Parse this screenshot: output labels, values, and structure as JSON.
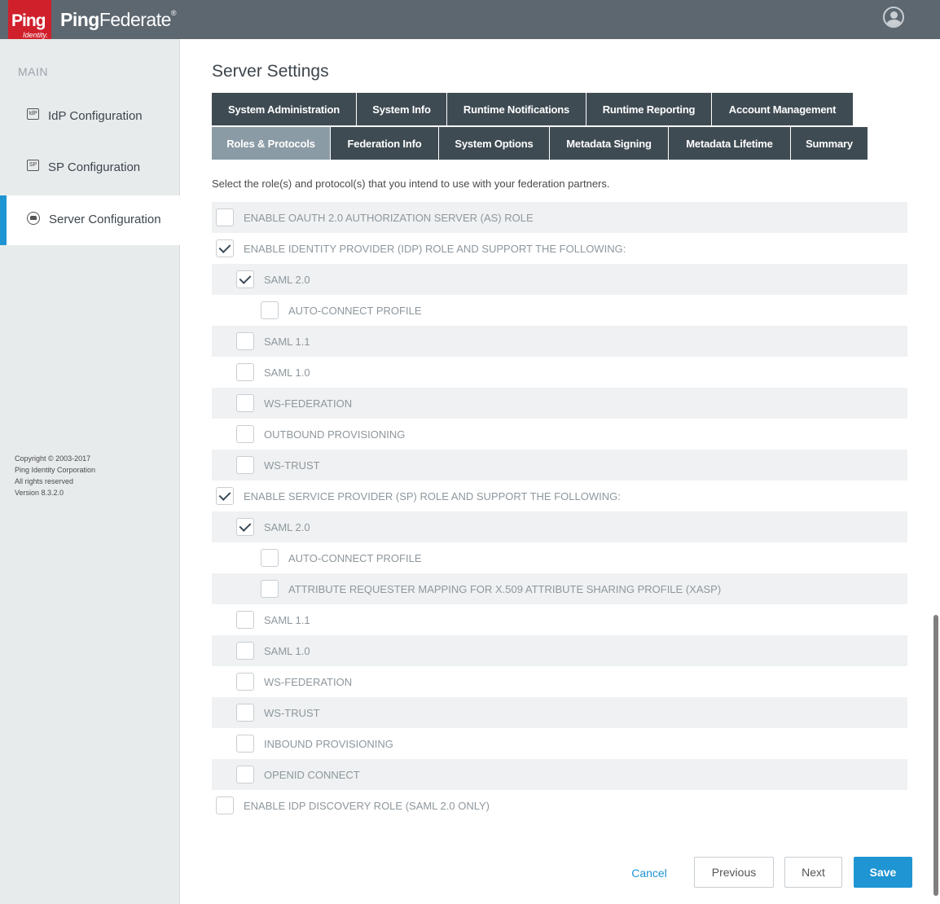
{
  "header": {
    "logo_word": "Ping",
    "logo_sub": "Identity.",
    "brand_a": "Ping",
    "brand_b": "Federate",
    "brand_mark": "®"
  },
  "sidebar": {
    "heading": "MAIN",
    "items": [
      {
        "label": "IdP Configuration",
        "icon": "IdP"
      },
      {
        "label": "SP Configuration",
        "icon": "SP"
      },
      {
        "label": "Server Configuration",
        "icon": "server"
      }
    ],
    "copyright": {
      "line1": "Copyright © 2003-2017",
      "line2": "Ping Identity Corporation",
      "line3": "All rights reserved",
      "line4": "Version 8.3.2.0"
    }
  },
  "main": {
    "title": "Server Settings",
    "tabs_row1": [
      "System Administration",
      "System Info",
      "Runtime Notifications",
      "Runtime Reporting",
      "Account Management"
    ],
    "tabs_row2": [
      "Roles & Protocols",
      "Federation Info",
      "System Options",
      "Metadata Signing",
      "Metadata Lifetime",
      "Summary"
    ],
    "active_tab": "Roles & Protocols",
    "instructions": "Select the role(s) and protocol(s) that you intend to use with your federation partners.",
    "options": [
      {
        "label": "ENABLE OAUTH 2.0 AUTHORIZATION SERVER (AS) ROLE",
        "checked": false
      },
      {
        "label": "ENABLE IDENTITY PROVIDER (IDP) ROLE AND SUPPORT THE FOLLOWING:",
        "checked": true
      },
      {
        "label": "SAML 2.0",
        "checked": true
      },
      {
        "label": "AUTO-CONNECT PROFILE",
        "checked": false
      },
      {
        "label": "SAML 1.1",
        "checked": false
      },
      {
        "label": "SAML 1.0",
        "checked": false
      },
      {
        "label": "WS-FEDERATION",
        "checked": false
      },
      {
        "label": "OUTBOUND PROVISIONING",
        "checked": false
      },
      {
        "label": "WS-TRUST",
        "checked": false
      },
      {
        "label": "ENABLE SERVICE PROVIDER (SP) ROLE AND SUPPORT THE FOLLOWING:",
        "checked": true
      },
      {
        "label": "SAML 2.0",
        "checked": true
      },
      {
        "label": "AUTO-CONNECT PROFILE",
        "checked": false
      },
      {
        "label": "ATTRIBUTE REQUESTER MAPPING FOR X.509 ATTRIBUTE SHARING PROFILE (XASP)",
        "checked": false
      },
      {
        "label": "SAML 1.1",
        "checked": false
      },
      {
        "label": "SAML 1.0",
        "checked": false
      },
      {
        "label": "WS-FEDERATION",
        "checked": false
      },
      {
        "label": "WS-TRUST",
        "checked": false
      },
      {
        "label": "INBOUND PROVISIONING",
        "checked": false
      },
      {
        "label": "OPENID CONNECT",
        "checked": false
      },
      {
        "label": "ENABLE IDP DISCOVERY ROLE (SAML 2.0 ONLY)",
        "checked": false
      }
    ]
  },
  "footer": {
    "cancel": "Cancel",
    "previous": "Previous",
    "next": "Next",
    "save": "Save"
  }
}
